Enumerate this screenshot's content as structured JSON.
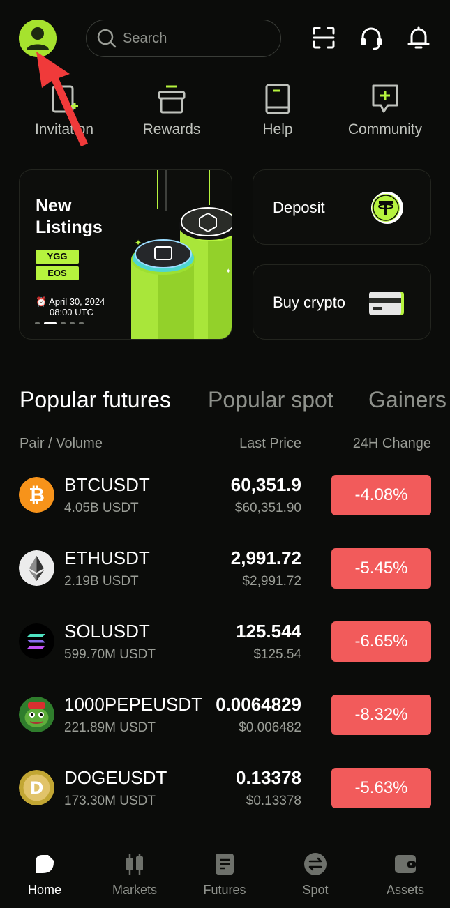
{
  "header": {
    "search_placeholder": "Search"
  },
  "shortcuts": [
    {
      "label": "Invitation",
      "icon": "invitation-icon"
    },
    {
      "label": "Rewards",
      "icon": "gift-icon"
    },
    {
      "label": "Help",
      "icon": "book-icon"
    },
    {
      "label": "Community",
      "icon": "chat-plus-icon"
    }
  ],
  "banner": {
    "title_line1": "New",
    "title_line2": "Listings",
    "tags": [
      "YGG",
      "EOS"
    ],
    "date": "April 30, 2024",
    "time": "08:00 UTC"
  },
  "cards": {
    "deposit": "Deposit",
    "buy_crypto": "Buy crypto"
  },
  "tabs": [
    "Popular futures",
    "Popular spot",
    "Gainers"
  ],
  "table": {
    "col_pair": "Pair / Volume",
    "col_price": "Last Price",
    "col_change": "24H Change",
    "rows": [
      {
        "pair": "BTCUSDT",
        "volume": "4.05B USDT",
        "price": "60,351.9",
        "price_usd": "$60,351.90",
        "change": "-4.08%"
      },
      {
        "pair": "ETHUSDT",
        "volume": "2.19B USDT",
        "price": "2,991.72",
        "price_usd": "$2,991.72",
        "change": "-5.45%"
      },
      {
        "pair": "SOLUSDT",
        "volume": "599.70M USDT",
        "price": "125.544",
        "price_usd": "$125.54",
        "change": "-6.65%"
      },
      {
        "pair": "1000PEPEUSDT",
        "volume": "221.89M USDT",
        "price": "0.0064829",
        "price_usd": "$0.006482",
        "change": "-8.32%"
      },
      {
        "pair": "DOGEUSDT",
        "volume": "173.30M USDT",
        "price": "0.13378",
        "price_usd": "$0.13378",
        "change": "-5.63%"
      }
    ]
  },
  "nav": [
    {
      "label": "Home",
      "active": true
    },
    {
      "label": "Markets",
      "active": false
    },
    {
      "label": "Futures",
      "active": false
    },
    {
      "label": "Spot",
      "active": false
    },
    {
      "label": "Assets",
      "active": false
    }
  ],
  "colors": {
    "accent": "#b6f33e",
    "negative": "#f25b5b",
    "background": "#0b0c0a"
  }
}
